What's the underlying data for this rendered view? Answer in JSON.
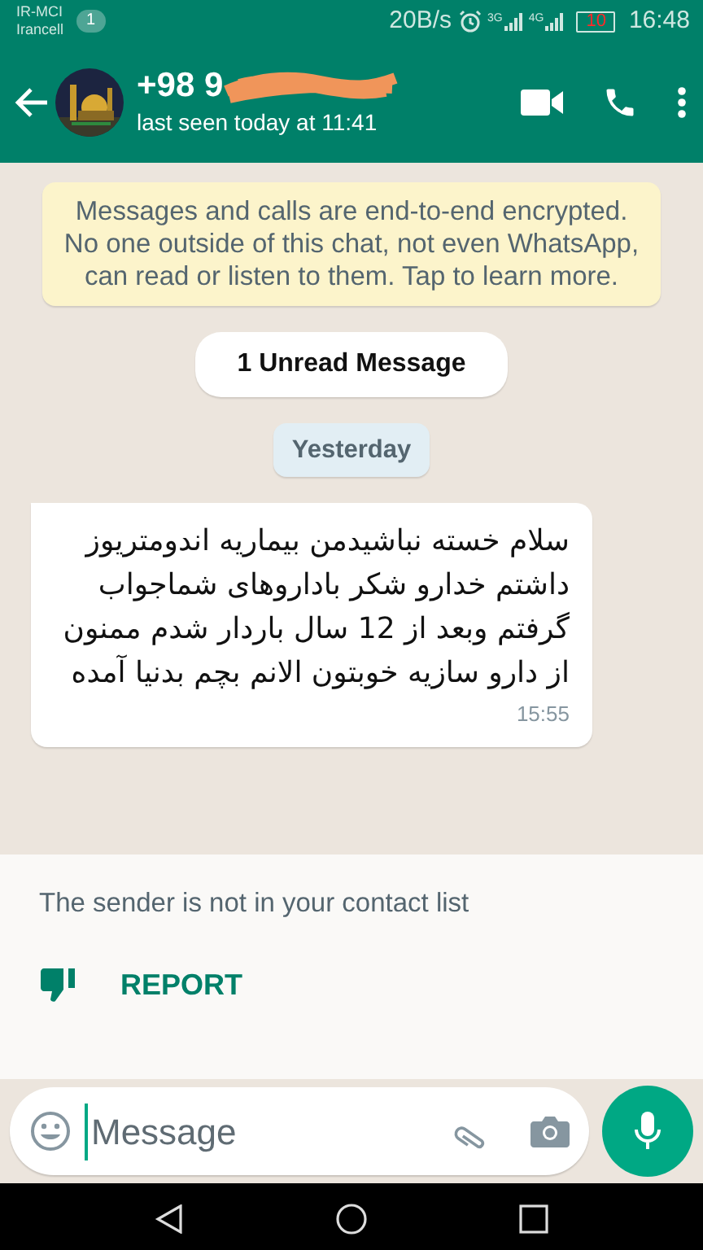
{
  "status_bar": {
    "carrier_1": "IR-MCI",
    "carrier_2": "Irancell",
    "sim_badge": "1",
    "speed": "20B/s",
    "network_1": "3G",
    "network_2": "4G",
    "battery": "10",
    "time": "16:48"
  },
  "header": {
    "contact": "+98 9",
    "last_seen": "last seen today at 11:41"
  },
  "encryption_notice": "Messages and calls are end-to-end encrypted. No one outside of this chat, not even WhatsApp, can read or listen to them. Tap to learn more.",
  "unread_divider": "1 Unread Message",
  "date_divider": "Yesterday",
  "messages": [
    {
      "text": "سلام خسته نباشیدمن بیماریه اندومتریوز داشتم خدارو شکر باداروهای شماجواب گرفتم وبعد از 12 سال باردار شدم ممنون از دارو سازیه خوبتون الانم بچم بدنیا آمده",
      "time": "15:55"
    }
  ],
  "unknown_sender": {
    "notice": "The sender is not in your contact list",
    "action": "REPORT"
  },
  "composer": {
    "placeholder": "Message"
  }
}
